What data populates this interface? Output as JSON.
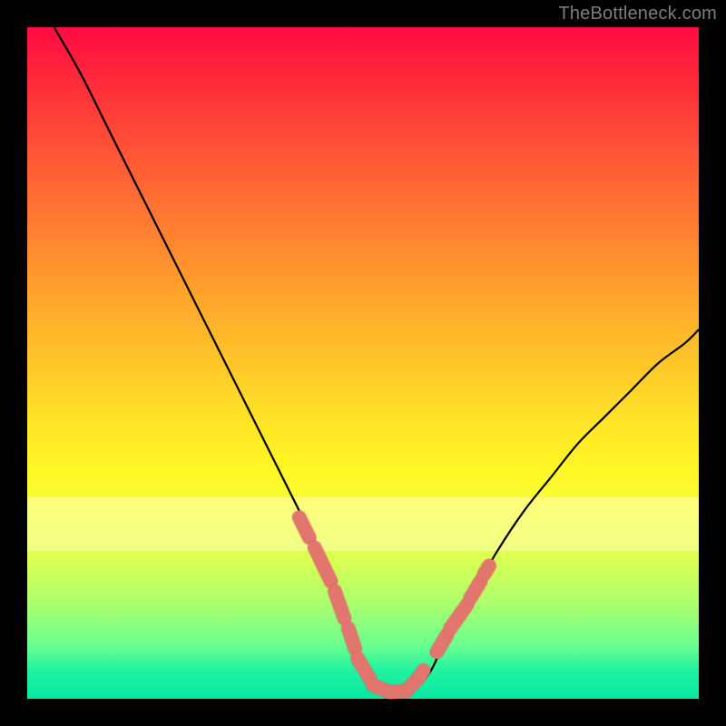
{
  "watermark": {
    "text": "TheBottleneck.com"
  },
  "colors": {
    "page_bg": "#000000",
    "curve": "#000000",
    "marker_fill": "#e2766f",
    "marker_stroke": "#cf5b54",
    "gradient_top": "#ff0b40",
    "gradient_bottom": "#07e9a3"
  },
  "chart_data": {
    "type": "line",
    "title": "",
    "xlabel": "",
    "ylabel": "",
    "xlim": [
      0,
      100
    ],
    "ylim": [
      0,
      100
    ],
    "grid": false,
    "legend": false,
    "series": [
      {
        "name": "bottleneck-curve",
        "x": [
          4,
          8,
          12,
          16,
          20,
          24,
          28,
          32,
          36,
          40,
          42,
          44,
          46,
          48,
          50,
          52,
          54,
          56,
          58,
          60,
          62,
          66,
          70,
          74,
          78,
          82,
          86,
          90,
          94,
          98,
          100
        ],
        "y": [
          100,
          93,
          85,
          77,
          69,
          61,
          53,
          45,
          37,
          29,
          25,
          21,
          16,
          10,
          5,
          2,
          1,
          1,
          2,
          4,
          8,
          15,
          22,
          28,
          33,
          38,
          42,
          46,
          50,
          53,
          55
        ]
      }
    ],
    "markers": {
      "name": "highlight-segments",
      "style": "stadium",
      "segments": [
        {
          "x": [
            40.5,
            42.0
          ],
          "y": [
            27.0,
            24.0
          ]
        },
        {
          "x": [
            42.8,
            45.2
          ],
          "y": [
            22.5,
            17.5
          ]
        },
        {
          "x": [
            45.8,
            47.2
          ],
          "y": [
            16.0,
            12.0
          ]
        },
        {
          "x": [
            47.8,
            48.8
          ],
          "y": [
            10.5,
            7.5
          ]
        },
        {
          "x": [
            49.2,
            51.0
          ],
          "y": [
            6.0,
            3.0
          ]
        },
        {
          "x": [
            51.5,
            53.5
          ],
          "y": [
            2.0,
            1.2
          ]
        },
        {
          "x": [
            54.0,
            56.5
          ],
          "y": [
            1.0,
            1.2
          ]
        },
        {
          "x": [
            57.0,
            58.2
          ],
          "y": [
            1.8,
            3.0
          ]
        },
        {
          "x": [
            58.5,
            59.0
          ],
          "y": [
            3.5,
            4.2
          ]
        },
        {
          "x": [
            61.0,
            62.5
          ],
          "y": [
            7.0,
            9.5
          ]
        },
        {
          "x": [
            63.0,
            65.5
          ],
          "y": [
            10.5,
            14.0
          ]
        },
        {
          "x": [
            66.0,
            67.5
          ],
          "y": [
            15.0,
            17.5
          ]
        },
        {
          "x": [
            68.0,
            68.8
          ],
          "y": [
            18.5,
            19.8
          ]
        }
      ]
    },
    "bands": [
      {
        "name": "pale-band",
        "y": [
          22,
          30
        ]
      }
    ]
  }
}
